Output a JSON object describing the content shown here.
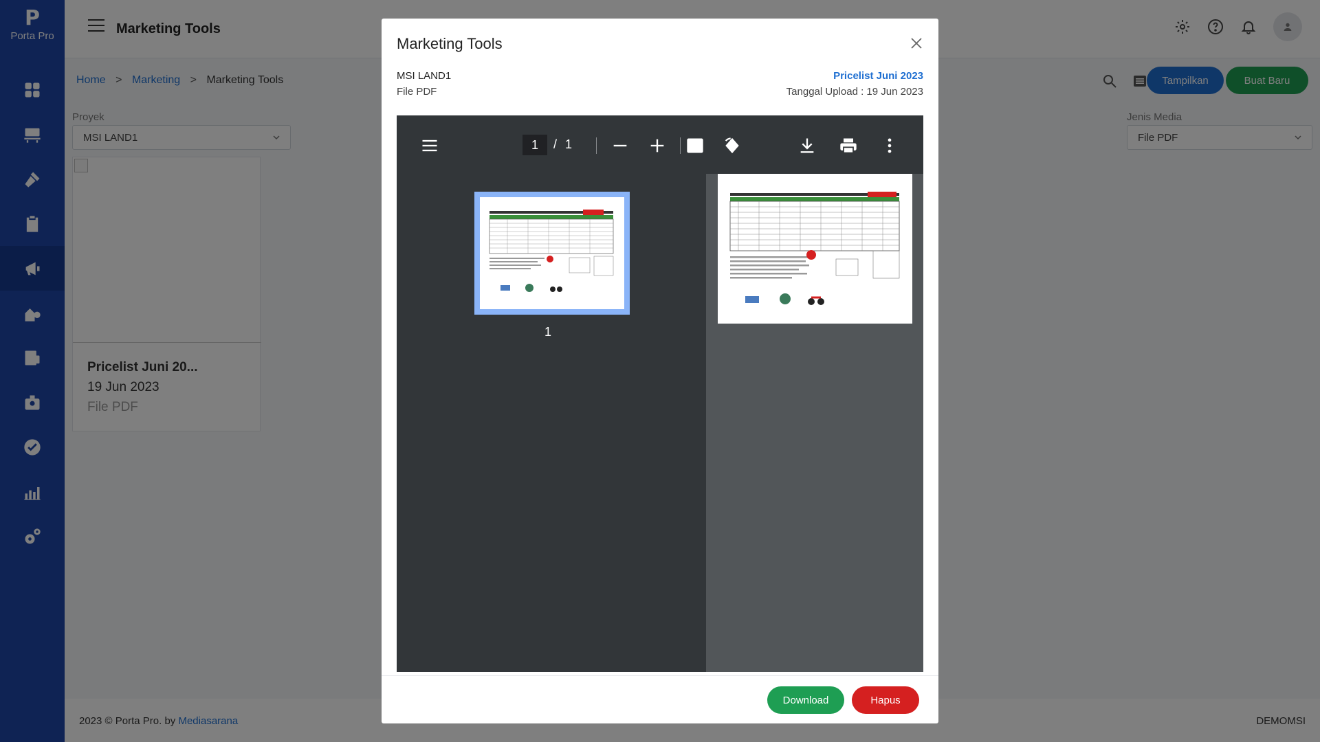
{
  "app": {
    "logo_text": "Porta Pro",
    "logo_mark": "P"
  },
  "sidebar": {
    "items": [
      {
        "icon": "dashboard-icon"
      },
      {
        "icon": "units-icon"
      },
      {
        "icon": "construction-icon"
      },
      {
        "icon": "clipboard-icon"
      },
      {
        "icon": "marketing-icon",
        "active": true
      },
      {
        "icon": "sales-icon"
      },
      {
        "icon": "finance-icon"
      },
      {
        "icon": "customer-icon"
      },
      {
        "icon": "approval-icon"
      },
      {
        "icon": "report-icon"
      },
      {
        "icon": "settings-icon"
      }
    ]
  },
  "topbar": {
    "title": "Marketing Tools"
  },
  "breadcrumb": {
    "home": "Home",
    "section": "Marketing",
    "current": "Marketing Tools",
    "separator": ">"
  },
  "actions": {
    "tampilkan": "Tampilkan",
    "buat_baru": "Buat Baru"
  },
  "filters": {
    "proyek_label": "Proyek",
    "proyek_value": "MSI LAND1",
    "media_label": "Jenis Media",
    "media_value": "File PDF"
  },
  "card": {
    "title": "Pricelist Juni 20...",
    "date": "19 Jun 2023",
    "type": "File PDF"
  },
  "footer": {
    "copyright": "2023 © Porta Pro. by ",
    "company": "Mediasarana",
    "user": "DEMOMSI"
  },
  "modal": {
    "title": "Marketing Tools",
    "project": "MSI LAND1",
    "file_type": "File PDF",
    "file_name": "Pricelist Juni 2023",
    "upload_date": "Tanggal Upload : 19 Jun 2023",
    "viewer": {
      "current_page": "1",
      "separator": "/",
      "total_pages": "1",
      "thumb_label": "1"
    },
    "download_label": "Download",
    "hapus_label": "Hapus"
  },
  "colors": {
    "sidebar": "#1f46a8",
    "accent_blue": "#1f6fd1",
    "green": "#1e9e53",
    "red": "#d52020"
  }
}
